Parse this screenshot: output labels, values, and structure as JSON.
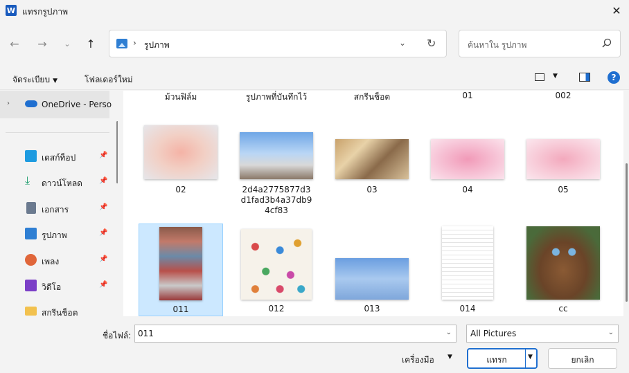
{
  "window": {
    "title": "แทรกรูปภาพ",
    "app_icon": "word-icon"
  },
  "nav": {
    "breadcrumb_root_icon": "pictures-folder-icon",
    "path": "รูปภาพ",
    "search_placeholder": "ค้นหาใน รูปภาพ"
  },
  "toolbar": {
    "organize": "จัดระเบียบ",
    "new_folder": "โฟลเดอร์ใหม่"
  },
  "sidebar": {
    "onedrive": "OneDrive - Perso",
    "items": [
      {
        "label": "เดสก์ท็อป",
        "icon": "desktop-icon",
        "color": "#1e9be0"
      },
      {
        "label": "ดาวน์โหลด",
        "icon": "download-icon",
        "color": "#1a9c6b"
      },
      {
        "label": "เอกสาร",
        "icon": "document-icon",
        "color": "#6b7a8f"
      },
      {
        "label": "รูปภาพ",
        "icon": "pictures-icon",
        "color": "#2f7fd3"
      },
      {
        "label": "เพลง",
        "icon": "music-icon",
        "color": "#e0663a"
      },
      {
        "label": "วิดีโอ",
        "icon": "video-icon",
        "color": "#7b3fc7"
      },
      {
        "label": "สกรีนช็อต",
        "icon": "folder-icon",
        "color": "#f2c14e"
      }
    ]
  },
  "content": {
    "top_labels": [
      "ม้วนฟิล์ม",
      "รูปภาพที่บันทึกไว้",
      "สกรีนช็อต",
      "01",
      "002"
    ],
    "files": [
      {
        "label": "02"
      },
      {
        "label": "2d4a2775877d3d1fad3b4a37db94cf83"
      },
      {
        "label": "03"
      },
      {
        "label": "04"
      },
      {
        "label": "05"
      },
      {
        "label": "011"
      },
      {
        "label": "012"
      },
      {
        "label": "013"
      },
      {
        "label": "014"
      },
      {
        "label": "cc"
      }
    ]
  },
  "bottom": {
    "filename_label": "ชื่อไฟล์:",
    "filename_value": "011",
    "filetype": "All Pictures",
    "tools": "เครื่องมือ",
    "insert": "แทรก",
    "cancel": "ยกเลิก"
  }
}
